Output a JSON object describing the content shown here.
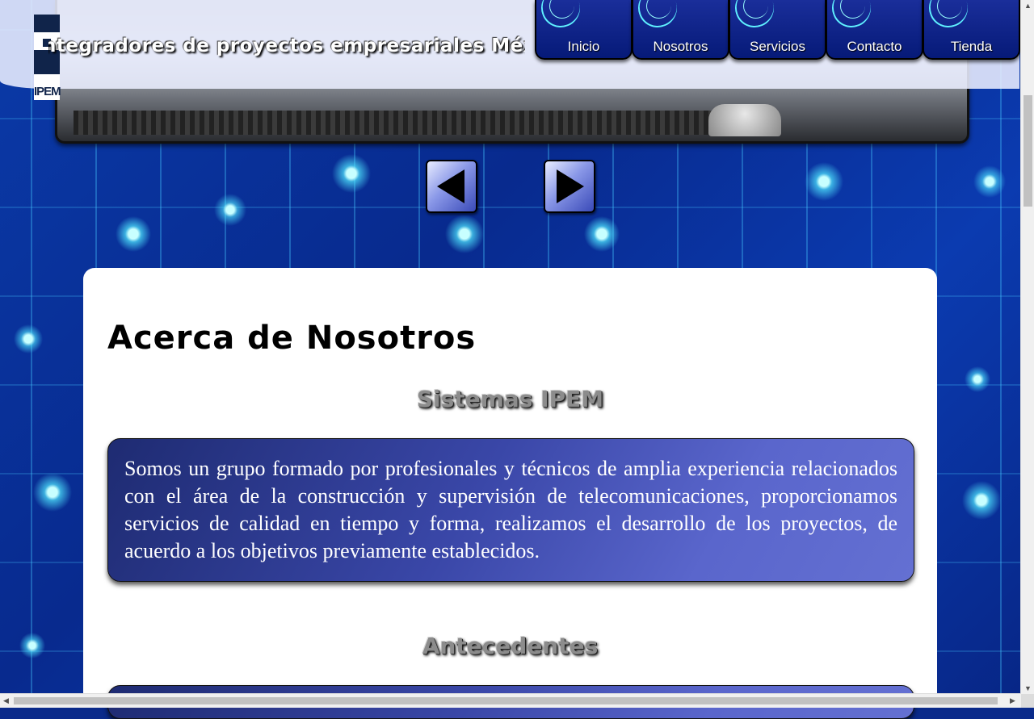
{
  "site": {
    "title": "Integradores de proyectos empresariales México",
    "logo_text": "IPEM"
  },
  "nav": {
    "items": [
      {
        "label": "Inicio"
      },
      {
        "label": "Nosotros"
      },
      {
        "label": "Servicios"
      },
      {
        "label": "Contacto"
      },
      {
        "label": "Tienda"
      }
    ]
  },
  "slider": {
    "prev_icon": "triangle-left-icon",
    "next_icon": "triangle-right-icon"
  },
  "main": {
    "page_title": "Acerca de Nosotros",
    "sections": [
      {
        "heading": "Sistemas IPEM",
        "text": "Somos un grupo formado por profesionales y técnicos de amplia experiencia relacionados con el área de la construcción y supervisión de telecomunicaciones, proporcionamos servicios de calidad en tiempo y forma, realizamos el desarrollo de los proyectos, de acuerdo a los objetivos previamente establecidos."
      },
      {
        "heading": "Antecedentes",
        "text": ""
      }
    ]
  },
  "colors": {
    "nav_bg": "#061a78",
    "nav_accent": "#5ff0ff",
    "card_start": "#1e2b72",
    "card_end": "#6470d2",
    "background": "#0a2a8a"
  }
}
